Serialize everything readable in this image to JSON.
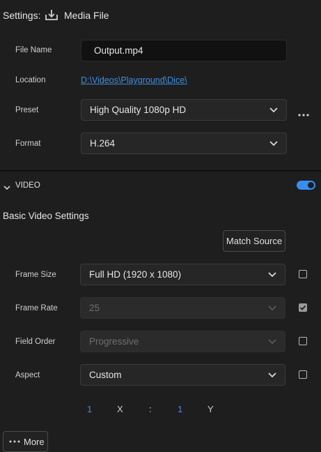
{
  "header": {
    "settings_label": "Settings:",
    "export_icon": "export-download-icon",
    "destination_label": "Media File"
  },
  "file": {
    "name_label": "File Name",
    "name_value": "Output.mp4",
    "location_label": "Location",
    "location_value": "D:\\Videos\\Playground\\Dice\\",
    "preset_label": "Preset",
    "preset_value": "High Quality 1080p HD",
    "preset_more_icon": "more-horizontal-icon",
    "format_label": "Format",
    "format_value": "H.264"
  },
  "video_section": {
    "title": "VIDEO",
    "enabled": true,
    "accent_color": "#378ef0"
  },
  "basic_video": {
    "title": "Basic Video Settings",
    "match_source_label": "Match Source",
    "frame_size_label": "Frame Size",
    "frame_size_value": "Full HD (1920 x 1080)",
    "frame_size_checked": false,
    "frame_rate_label": "Frame Rate",
    "frame_rate_value": "25",
    "frame_rate_checked": true,
    "field_order_label": "Field Order",
    "field_order_value": "Progressive",
    "field_order_checked": false,
    "aspect_label": "Aspect",
    "aspect_value": "Custom",
    "aspect_checked": false,
    "aspect_x_value": "1",
    "aspect_x_label": "X",
    "aspect_separator": ":",
    "aspect_y_value": "1",
    "aspect_y_label": "Y"
  },
  "more_button_label": "More"
}
